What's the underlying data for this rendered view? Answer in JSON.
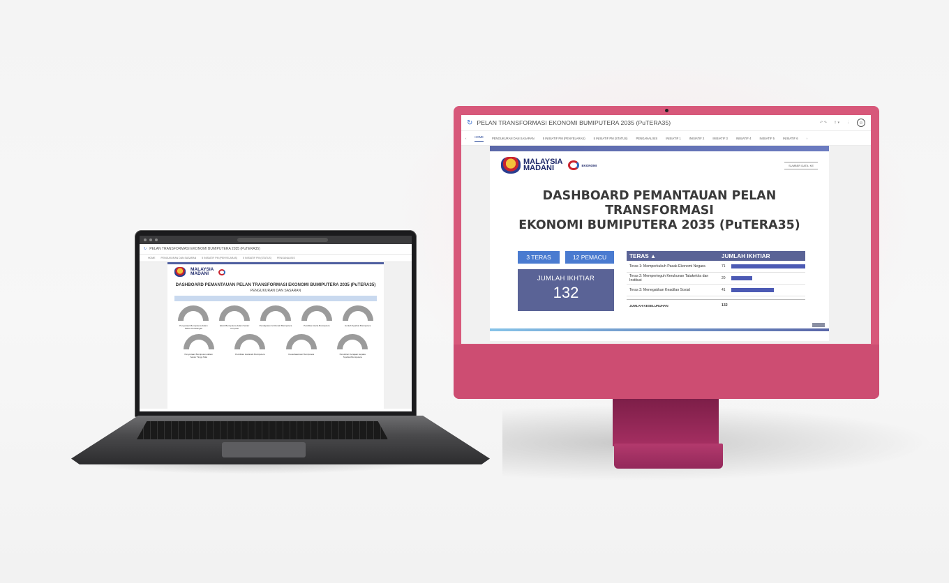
{
  "laptop": {
    "app_title": "PELAN TRANSFORMASI EKONOMI BUMIPUTERA 2035 (PuTERA35)",
    "dashboard_title": "DASHBOARD PEMANTAUAN PELAN TRANSFORMASI EKONOMI BUMIPUTERA 2035 (PuTERA35)",
    "subtitle": "PENGUKURAN DAN SASARAN",
    "gauge_labels": [
      "Penyertaan Bumiputera dalam Sektor Perkilangan",
      "Ekuiti Bumiputera dalam Sektor Korporat",
      "Pendapatan Isi Rumah Bumiputera",
      "Pemilikan Harta Bumiputera",
      "Jumlah Syarikat Bumiputera",
      "Penyertaan Bumiputera dalam Sektor Tinggi Nilai",
      "Pemilikan Hartanah Bumiputera",
      "Keusahawanan Bumiputera",
      "Perolehan Kerajaan kepada Syarikat Bumiputera"
    ]
  },
  "monitor": {
    "app_title": "PELAN TRANSFORMASI EKONOMI BUMIPUTERA 2035 (PuTERA35)",
    "tabs": [
      "HOME",
      "PENGUKURAN DAN SASARAN",
      "5 INISIATIF PM (PENYELARAS)",
      "5 INISIATIF PM (STATUS)",
      "PENGANALISIS",
      "INISIATIF 1",
      "INISIATIF 2",
      "INISIATIF 3",
      "INISIATIF 4",
      "INISIATIF 5",
      "INISIATIF 6"
    ],
    "logo_text_1": "MALAYSIA",
    "logo_text_2": "MADANI",
    "logo_ekonomi": "EKONOMI",
    "sumber": "SUMBER DATA: KE",
    "heading_line1": "DASHBOARD PEMANTAUAN PELAN TRANSFORMASI",
    "heading_line2": "EKONOMI BUMIPUTERA 2035 (PuTERA35)",
    "kpi": {
      "teras_btn": "3 TERAS",
      "pemacu_btn": "12 PEMACU",
      "label": "JUMLAH IKHTIAR",
      "value": "132"
    },
    "table": {
      "col1": "TERAS ▲",
      "col2": "JUMLAH IKHTIAR",
      "rows": [
        {
          "teras": "Teras 1: Memperkukuh Pasak Ekonomi Negara",
          "jumlah": "71",
          "value": 71
        },
        {
          "teras": "Teras 2: Memperteguh Kerukunan Tatakelola dan Institusi",
          "jumlah": "20",
          "value": 20
        },
        {
          "teras": "Teras 3: Menegakkan Keadilan Sosial",
          "jumlah": "41",
          "value": 41
        }
      ],
      "total_label": "JUMLAH KESELURUHAN",
      "total_value": "132"
    },
    "colors": {
      "accent": "#5a6396",
      "button": "#4a7bd0",
      "bar": "#4c5ab4",
      "monitor": "#d7587a"
    }
  }
}
